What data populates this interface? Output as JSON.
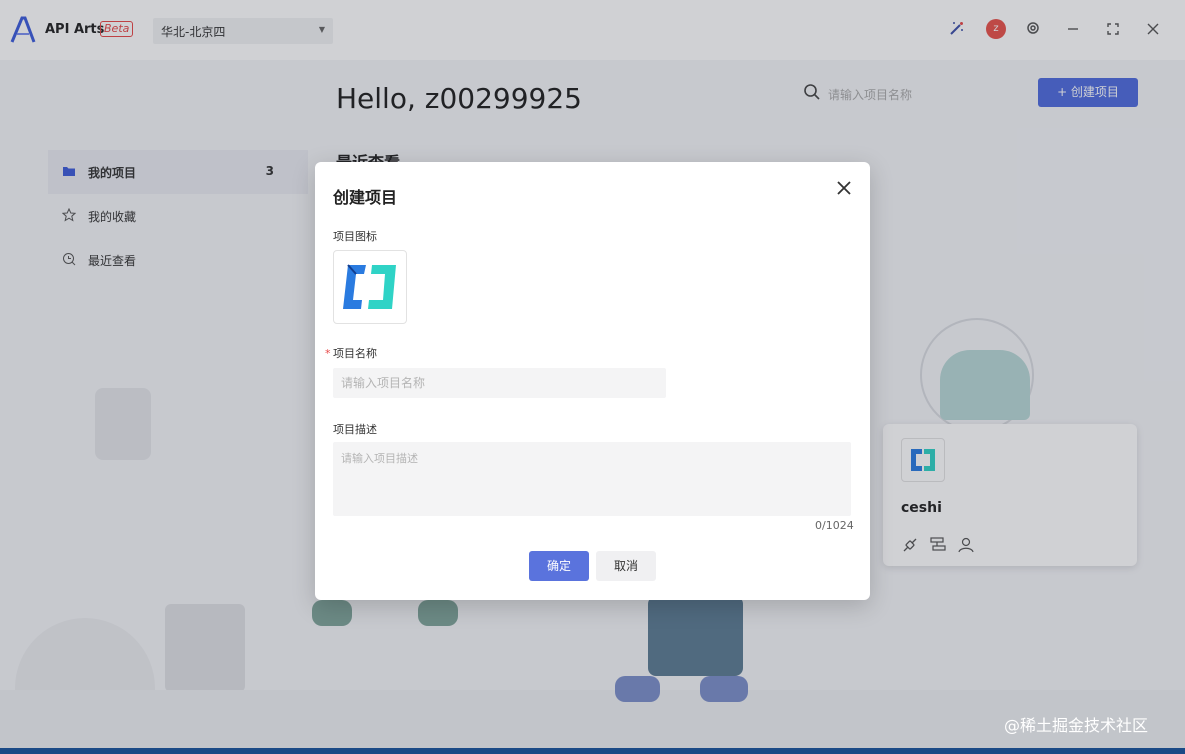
{
  "app": {
    "name": "API Arts",
    "badge": "Beta"
  },
  "header": {
    "region": "华北-北京四",
    "user_initial": "z"
  },
  "main": {
    "greeting": "Hello, z00299925",
    "search_placeholder": "请输入项目名称",
    "create_button": "+ 创建项目",
    "recent_heading": "最近查看"
  },
  "sidebar": {
    "items": [
      {
        "label": "我的项目",
        "count": "3",
        "icon": "folder-icon"
      },
      {
        "label": "我的收藏",
        "icon": "star-icon"
      },
      {
        "label": "最近查看",
        "icon": "recent-icon"
      }
    ]
  },
  "project_card": {
    "title": "ceshi"
  },
  "dialog": {
    "title": "创建项目",
    "icon_label": "项目图标",
    "name_label": "项目名称",
    "required_mark": "*",
    "name_placeholder": "请输入项目名称",
    "desc_label": "项目描述",
    "desc_placeholder": "请输入项目描述",
    "counter": "0/1024",
    "confirm": "确定",
    "cancel": "取消"
  },
  "watermark": "@稀土掘金技术社区",
  "colors": {
    "primary": "#4f6bde",
    "danger": "#e84747"
  }
}
